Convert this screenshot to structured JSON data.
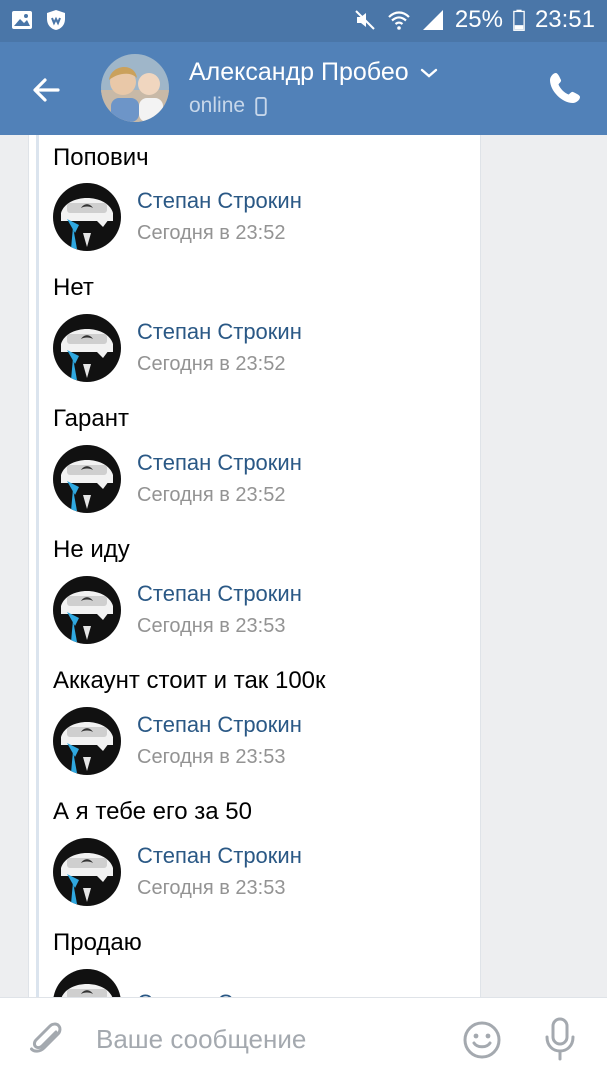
{
  "status_bar": {
    "battery_percent": "25%",
    "time": "23:51",
    "icons": [
      "gallery-icon",
      "shield-app-icon",
      "mute-icon",
      "wifi-icon",
      "signal-icon",
      "battery-icon"
    ]
  },
  "header": {
    "contact_name": "Александр Пробео",
    "status": "online",
    "icons": [
      "back-arrow-icon",
      "chevron-down-icon",
      "mobile-device-icon",
      "phone-icon"
    ]
  },
  "messages": [
    {
      "text": "Попович"
    },
    {
      "author": "Степан Строкин",
      "time": "Сегодня в 23:52",
      "text": "Нет"
    },
    {
      "author": "Степан Строкин",
      "time": "Сегодня в 23:52",
      "text": "Гарант"
    },
    {
      "author": "Степан Строкин",
      "time": "Сегодня в 23:52",
      "text": "Не иду"
    },
    {
      "author": "Степан Строкин",
      "time": "Сегодня в 23:53",
      "text": "Аккаунт стоит и так 100к"
    },
    {
      "author": "Степан Строкин",
      "time": "Сегодня в 23:53",
      "text": "А я тебе его за 50"
    },
    {
      "author": "Степан Строкин",
      "time": "Сегодня в 23:53",
      "text": "Продаю"
    },
    {
      "author": "Степан Строкин"
    }
  ],
  "composer": {
    "placeholder": "Ваше сообщение",
    "icons": [
      "attach-icon",
      "emoji-icon",
      "mic-icon"
    ]
  },
  "colors": {
    "header": "#5181b8",
    "status_bar": "#4a76a8",
    "author_name": "#2a5885",
    "timestamp": "#939393"
  }
}
